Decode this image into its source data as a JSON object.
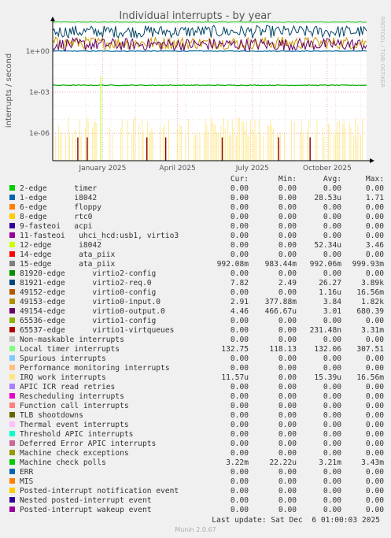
{
  "chart_data": {
    "type": "line",
    "title": "Individual interrupts - by year",
    "ylabel": "interrupts / second",
    "y_scale": "log",
    "ylim": [
      1e-08,
      100.0
    ],
    "y_ticks": [
      {
        "value": 1,
        "label": "1e+00"
      },
      {
        "value": 0.001,
        "label": "1e-03"
      },
      {
        "value": 1e-06,
        "label": "1e-06"
      }
    ],
    "x_ticks": [
      "January 2025",
      "April 2025",
      "July 2025",
      "October 2025"
    ],
    "grid": true,
    "side_text": "RRDTOOL / TOBI OETIKER",
    "series_plotted": [
      {
        "name": "Local timer interrupts",
        "level": 132.06,
        "color": "#4CD94C",
        "style": "flat"
      },
      {
        "name": "81920-edge",
        "level": 0.99206,
        "color": "#006699",
        "style": "flat"
      },
      {
        "name": "81921-edge",
        "level": 26.27,
        "color": "#004466",
        "style": "noisy"
      },
      {
        "name": "49153-gedge",
        "level": 3.84,
        "color": "#CC9900",
        "style": "noisy"
      },
      {
        "name": "49154-edge",
        "level": 3.01,
        "color": "#660066",
        "style": "noisy"
      },
      {
        "name": "Machine check polls",
        "level": 0.00321,
        "color": "#00AA00",
        "style": "flat"
      },
      {
        "name": "IRQ work interrupts",
        "level": 1.539e-05,
        "color": "#FFE680",
        "style": "spiky"
      },
      {
        "name": "65537-edge",
        "level": 2.3148e-07,
        "color": "#880000",
        "style": "spikes"
      }
    ]
  },
  "legend": {
    "headers": {
      "cur": "Cur:",
      "min": "Min:",
      "avg": "Avg:",
      "max": "Max:"
    },
    "rows": [
      {
        "label": "2-edge      timer",
        "color": "#00CC00",
        "cur": "0.00",
        "min": "0.00",
        "avg": "0.00",
        "max": "0.00"
      },
      {
        "label": "1-edge      i8042",
        "color": "#0066B3",
        "cur": "0.00",
        "min": "0.00",
        "avg": "28.53u",
        "max": "1.71"
      },
      {
        "label": "6-edge      floppy",
        "color": "#FF8000",
        "cur": "0.00",
        "min": "0.00",
        "avg": "0.00",
        "max": "0.00"
      },
      {
        "label": "8-edge      rtc0",
        "color": "#FFCC00",
        "cur": "0.00",
        "min": "0.00",
        "avg": "0.00",
        "max": "0.00"
      },
      {
        "label": "9-fasteoi   acpi",
        "color": "#330099",
        "cur": "0.00",
        "min": "0.00",
        "avg": "0.00",
        "max": "0.00"
      },
      {
        "label": "11-fasteoi   uhci_hcd:usb1, virtio3",
        "color": "#990099",
        "cur": "0.00",
        "min": "0.00",
        "avg": "0.00",
        "max": "0.00"
      },
      {
        "label": "12-edge      i8042",
        "color": "#CCFF00",
        "cur": "0.00",
        "min": "0.00",
        "avg": "52.34u",
        "max": "3.46"
      },
      {
        "label": "14-edge      ata_piix",
        "color": "#FF0000",
        "cur": "0.00",
        "min": "0.00",
        "avg": "0.00",
        "max": "0.00"
      },
      {
        "label": "15-edge      ata_piix",
        "color": "#808080",
        "cur": "992.08m",
        "min": "983.44m",
        "avg": "992.06m",
        "max": "999.93m"
      },
      {
        "label": "81920-edge      virtio2-config",
        "color": "#008F00",
        "cur": "0.00",
        "min": "0.00",
        "avg": "0.00",
        "max": "0.00"
      },
      {
        "label": "81921-edge      virtio2-req.0",
        "color": "#00487D",
        "cur": "7.82",
        "min": "2.49",
        "avg": "26.27",
        "max": "3.89k"
      },
      {
        "label": "49152-edge      virtio0-config",
        "color": "#B35A00",
        "cur": "0.00",
        "min": "0.00",
        "avg": "1.16u",
        "max": "16.56m"
      },
      {
        "label": "49153-edge      virtio0-input.0",
        "color": "#B38F00",
        "cur": "2.91",
        "min": "377.88m",
        "avg": "3.84",
        "max": "1.82k"
      },
      {
        "label": "49154-edge      virtio0-output.0",
        "color": "#6B006B",
        "cur": "4.46",
        "min": "466.67u",
        "avg": "3.01",
        "max": "680.39"
      },
      {
        "label": "65536-edge      virtio1-config",
        "color": "#8FB300",
        "cur": "0.00",
        "min": "0.00",
        "avg": "0.00",
        "max": "0.00"
      },
      {
        "label": "65537-edge      virtio1-virtqueues",
        "color": "#B30000",
        "cur": "0.00",
        "min": "0.00",
        "avg": "231.48n",
        "max": "3.31m"
      },
      {
        "label": "Non-maskable interrupts",
        "color": "#BEBEBE",
        "cur": "0.00",
        "min": "0.00",
        "avg": "0.00",
        "max": "0.00"
      },
      {
        "label": "Local timer interrupts",
        "color": "#80FF80",
        "cur": "132.75",
        "min": "118.13",
        "avg": "132.06",
        "max": "307.51"
      },
      {
        "label": "Spurious interrupts",
        "color": "#80C9FF",
        "cur": "0.00",
        "min": "0.00",
        "avg": "0.00",
        "max": "0.00"
      },
      {
        "label": "Performance monitoring interrupts",
        "color": "#FFC080",
        "cur": "0.00",
        "min": "0.00",
        "avg": "0.00",
        "max": "0.00"
      },
      {
        "label": "IRQ work interrupts",
        "color": "#FFE680",
        "cur": "11.57u",
        "min": "0.00",
        "avg": "15.39u",
        "max": "16.56m"
      },
      {
        "label": "APIC ICR read retries",
        "color": "#AA80FF",
        "cur": "0.00",
        "min": "0.00",
        "avg": "0.00",
        "max": "0.00"
      },
      {
        "label": "Rescheduling interrupts",
        "color": "#EE00CC",
        "cur": "0.00",
        "min": "0.00",
        "avg": "0.00",
        "max": "0.00"
      },
      {
        "label": "Function call interrupts",
        "color": "#FF8080",
        "cur": "0.00",
        "min": "0.00",
        "avg": "0.00",
        "max": "0.00"
      },
      {
        "label": "TLB shootdowns",
        "color": "#666600",
        "cur": "0.00",
        "min": "0.00",
        "avg": "0.00",
        "max": "0.00"
      },
      {
        "label": "Thermal event interrupts",
        "color": "#FFBFFF",
        "cur": "0.00",
        "min": "0.00",
        "avg": "0.00",
        "max": "0.00"
      },
      {
        "label": "Threshold APIC interrupts",
        "color": "#00FFCC",
        "cur": "0.00",
        "min": "0.00",
        "avg": "0.00",
        "max": "0.00"
      },
      {
        "label": "Deferred Error APIC interrupts",
        "color": "#CC6699",
        "cur": "0.00",
        "min": "0.00",
        "avg": "0.00",
        "max": "0.00"
      },
      {
        "label": "Machine check exceptions",
        "color": "#999900",
        "cur": "0.00",
        "min": "0.00",
        "avg": "0.00",
        "max": "0.00"
      },
      {
        "label": "Machine check polls",
        "color": "#00CC00",
        "cur": "3.22m",
        "min": "22.22u",
        "avg": "3.21m",
        "max": "3.43m"
      },
      {
        "label": "ERR",
        "color": "#0066B3",
        "cur": "0.00",
        "min": "0.00",
        "avg": "0.00",
        "max": "0.00"
      },
      {
        "label": "MIS",
        "color": "#FF8000",
        "cur": "0.00",
        "min": "0.00",
        "avg": "0.00",
        "max": "0.00"
      },
      {
        "label": "Posted-interrupt notification event",
        "color": "#FFCC00",
        "cur": "0.00",
        "min": "0.00",
        "avg": "0.00",
        "max": "0.00"
      },
      {
        "label": "Nested posted-interrupt event",
        "color": "#330099",
        "cur": "0.00",
        "min": "0.00",
        "avg": "0.00",
        "max": "0.00"
      },
      {
        "label": "Posted-interrupt wakeup event",
        "color": "#990099",
        "cur": "0.00",
        "min": "0.00",
        "avg": "0.00",
        "max": "0.00"
      }
    ]
  },
  "last_update": "Last update: Sat Dec  6 01:00:03 2025",
  "footer": "Munin 2.0.67"
}
